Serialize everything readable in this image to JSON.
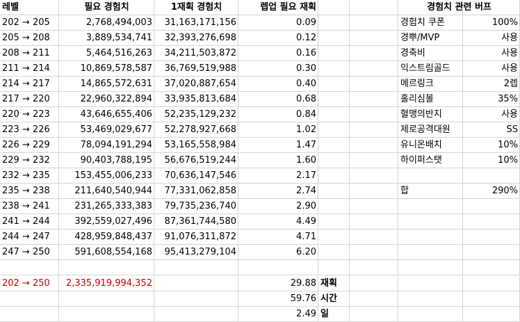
{
  "table": {
    "headers": [
      "레벨",
      "필요 경험치",
      "1재획 경험치",
      "렙업 필요 재획"
    ],
    "rows": [
      [
        "202 → 205",
        "2,768,494,003",
        "31,163,171,156",
        "0.09"
      ],
      [
        "205 → 208",
        "3,889,534,741",
        "32,393,276,698",
        "0.12"
      ],
      [
        "208 → 211",
        "5,464,516,263",
        "34,211,503,872",
        "0.16"
      ],
      [
        "211 → 214",
        "10,869,578,587",
        "36,769,519,988",
        "0.30"
      ],
      [
        "214 → 217",
        "14,865,572,631",
        "37,020,887,654",
        "0.40"
      ],
      [
        "217 → 220",
        "22,960,322,894",
        "33,935,813,684",
        "0.68"
      ],
      [
        "220 → 223",
        "43,646,655,406",
        "52,235,129,232",
        "0.84"
      ],
      [
        "223 → 226",
        "53,469,029,677",
        "52,278,927,668",
        "1.02"
      ],
      [
        "226 → 229",
        "78,094,191,294",
        "53,165,558,984",
        "1.47"
      ],
      [
        "229 → 232",
        "90,403,788,195",
        "56,676,519,244",
        "1.60"
      ],
      [
        "232 → 235",
        "153,455,006,233",
        "70,636,147,546",
        "2.17"
      ],
      [
        "235 → 238",
        "211,640,540,944",
        "77,331,062,858",
        "2.74"
      ],
      [
        "238 → 241",
        "231,265,333,383",
        "79,735,236,740",
        "2.90"
      ],
      [
        "241 → 244",
        "392,559,027,496",
        "87,361,744,580",
        "4.49"
      ],
      [
        "244 → 247",
        "428,959,848,437",
        "91,076,311,872",
        "4.71"
      ],
      [
        "247 → 250",
        "591,608,554,168",
        "95,413,279,104",
        "6.20"
      ]
    ],
    "total": {
      "level": "202 → 250",
      "exp": "2,335,919,994,352"
    },
    "summary": [
      {
        "value": "29.88",
        "unit": "재획"
      },
      {
        "value": "59.76",
        "unit": "시간"
      },
      {
        "value": "2.49",
        "unit": "일"
      }
    ]
  },
  "buffs": {
    "title": "경험치 관련 버프",
    "items": [
      [
        "경험치 쿠폰",
        "100%"
      ],
      [
        "경뿌/MVP",
        "사용"
      ],
      [
        "경축비",
        "사용"
      ],
      [
        "익스트림골드",
        "사용"
      ],
      [
        "메르링크",
        "2렙"
      ],
      [
        "홀리심볼",
        "35%"
      ],
      [
        "혈맹의반지",
        "사용"
      ],
      [
        "제로공격대원",
        "SS"
      ],
      [
        "유니온배치",
        "10%"
      ],
      [
        "하이퍼스탯",
        "10%"
      ]
    ],
    "sum_label": "합",
    "sum_value": "290%"
  }
}
